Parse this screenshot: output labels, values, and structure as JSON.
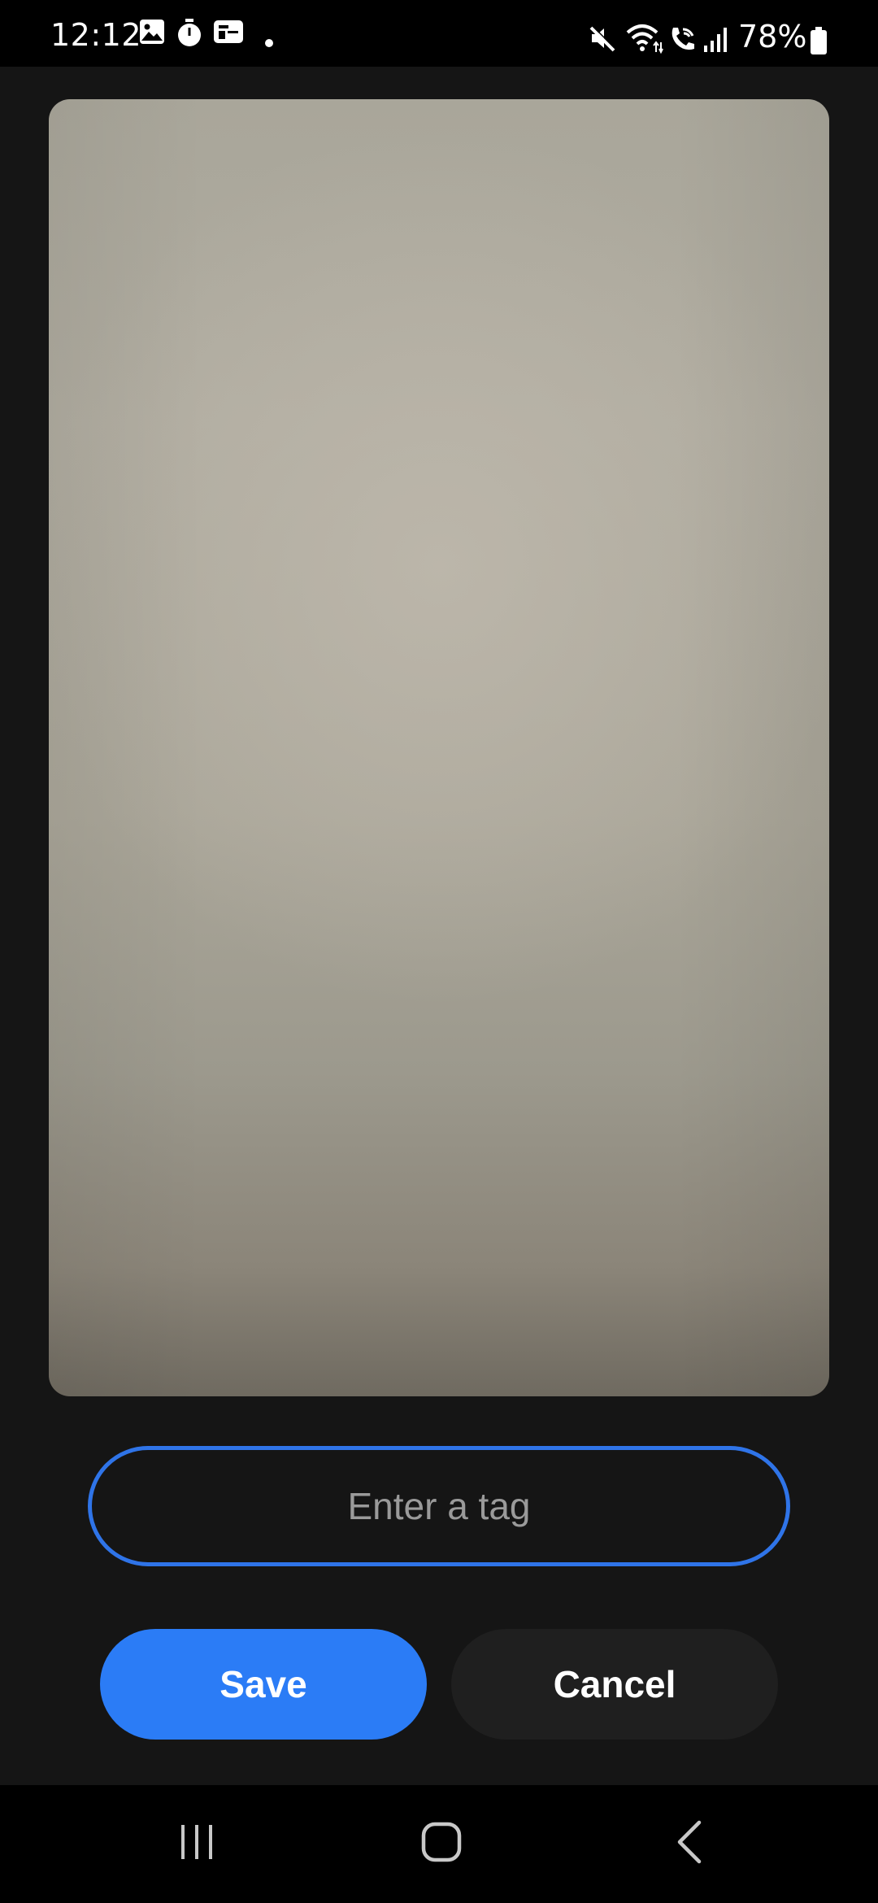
{
  "status_bar": {
    "time": "12:12",
    "battery_percent": "78%",
    "left_icons": [
      "gallery-icon",
      "timer-icon",
      "news-icon",
      "dot-icon"
    ],
    "right_icons": [
      "mute-icon",
      "wifi-icon",
      "wifi-calling-icon",
      "signal-icon",
      "battery-icon"
    ]
  },
  "preview": {
    "description_icon": "photo-preview"
  },
  "tag_input": {
    "placeholder": "Enter a tag",
    "value": "",
    "border_color": "#2f74e8"
  },
  "actions": {
    "save_label": "Save",
    "cancel_label": "Cancel",
    "save_color": "#2b7cf6",
    "cancel_color": "#1f1f1f"
  },
  "nav_bar": {
    "items": [
      "recent-apps-icon",
      "home-icon",
      "back-icon"
    ]
  }
}
